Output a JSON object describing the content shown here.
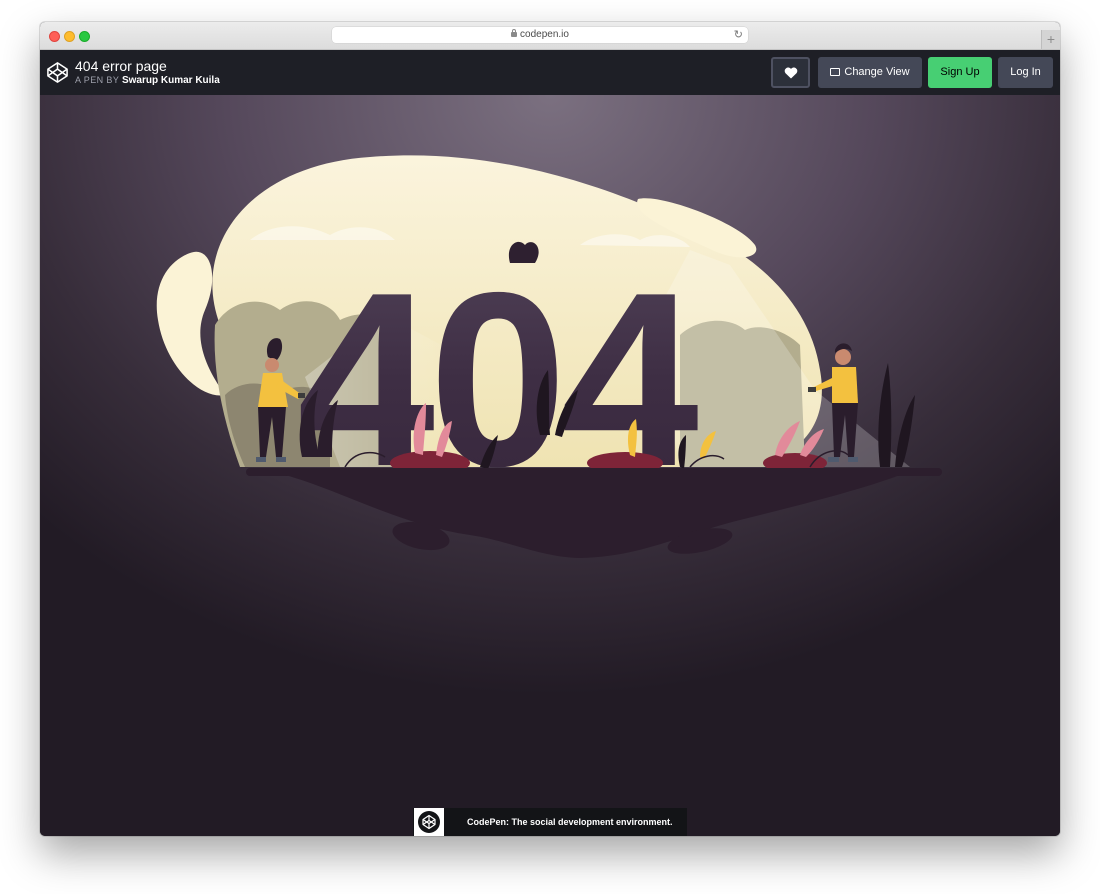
{
  "browser": {
    "url": "codepen.io",
    "new_tab_symbol": "+"
  },
  "header": {
    "pen_title": "404 error page",
    "byline_prefix": "A PEN BY",
    "author": "Swarup Kumar Kuila",
    "buttons": {
      "change_view": "Change View",
      "sign_up": "Sign Up",
      "log_in": "Log In"
    }
  },
  "illustration": {
    "text": "404"
  },
  "banner": {
    "text": "CodePen: The social development environment."
  },
  "colors": {
    "header_bg": "#1e1f26",
    "button_gray": "#444857",
    "signup_green": "#47cf73",
    "stage_top": "#7b7080",
    "stage_bottom": "#221b25",
    "cream": "#f9f1d4",
    "digits": "#3b2a3f",
    "ground": "#2c1e2d",
    "shirt_yellow": "#f3c13f"
  }
}
